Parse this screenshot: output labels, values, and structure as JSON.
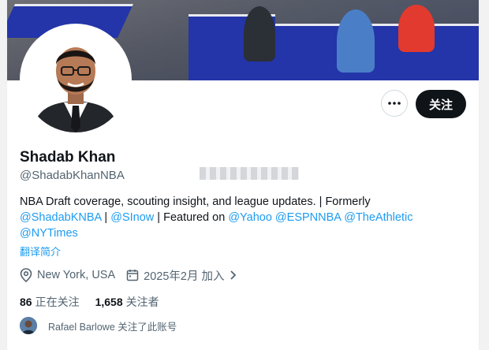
{
  "profile": {
    "name": "Shadab Khan",
    "handle": "@ShadabKhanNBA",
    "bio_text_1": "NBA Draft coverage, scouting insight, and league updates. | Formerly",
    "bio_link_1": "@ShadabKNBA",
    "bio_sep_1": " | ",
    "bio_link_2": "@SInow",
    "bio_text_2": " | Featured on ",
    "bio_link_3": "@Yahoo",
    "bio_link_4": "@ESPNNBA",
    "bio_link_5": "@TheAthletic",
    "bio_link_6": "@NYTimes",
    "translate_label": "翻译简介",
    "location": "New York, USA",
    "joined": "2025年2月 加入"
  },
  "actions": {
    "follow_label": "关注"
  },
  "stats": {
    "following_count": "86",
    "following_label": "正在关注",
    "followers_count": "1,658",
    "followers_label": "关注者"
  },
  "followed_by": {
    "text": "Rafael Barlowe 关注了此账号"
  },
  "icons": {
    "more": "more-horizontal-icon",
    "location": "location-pin-icon",
    "calendar": "calendar-icon",
    "chevron": "chevron-right-icon"
  },
  "colors": {
    "link": "#1d9bf0",
    "follow_button": "#0f1419",
    "secondary_text": "#536471"
  }
}
